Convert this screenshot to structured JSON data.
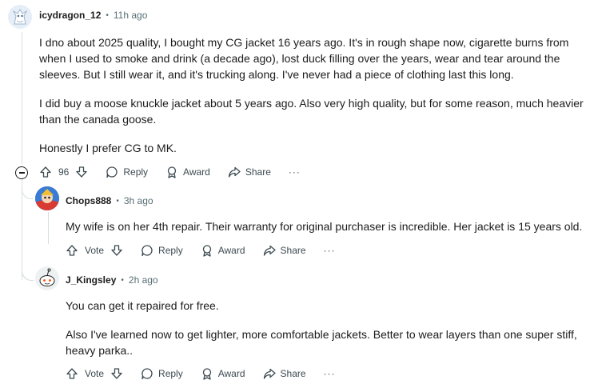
{
  "comments": [
    {
      "author": "icydragon_12",
      "separator": "•",
      "time": "11h ago",
      "paragraphs": [
        "I dno about 2025 quality, I bought my CG jacket 16 years ago. It's in rough shape now, cigarette burns from when I used to smoke and drink (a decade ago), lost duck filling over the years, wear and tear around the sleeves. But I still wear it, and it's trucking along. I've never had a piece of clothing last this long.",
        "I did buy a moose knuckle jacket about 5 years ago. Also very high quality, but for some reason, much heavier than the canada goose.",
        "Honestly I prefer CG to MK."
      ],
      "votes": "96",
      "reply_label": "Reply",
      "award_label": "Award",
      "share_label": "Share",
      "more_label": "···"
    },
    {
      "author": "Chops888",
      "separator": "•",
      "time": "3h ago",
      "paragraphs": [
        "My wife is on her 4th repair. Their warranty for original purchaser is incredible. Her jacket is 15 years old."
      ],
      "votes": "Vote",
      "reply_label": "Reply",
      "award_label": "Award",
      "share_label": "Share",
      "more_label": "···"
    },
    {
      "author": "J_Kingsley",
      "separator": "•",
      "time": "2h ago",
      "paragraphs": [
        "You can get it repaired for free.",
        "Also I've learned now to get lighter, more comfortable jackets. Better to wear layers than one super stiff, heavy parka.."
      ],
      "votes": "Vote",
      "reply_label": "Reply",
      "award_label": "Award",
      "share_label": "Share",
      "more_label": "···"
    }
  ],
  "icons": {
    "upvote": "upvote-icon",
    "downvote": "downvote-icon",
    "reply": "comment-icon",
    "award": "award-icon",
    "share": "share-icon",
    "collapse": "collapse-icon"
  },
  "colors": {
    "text": "#1c1c1c",
    "meta": "#576f76",
    "thread_line": "#d8dde0"
  }
}
